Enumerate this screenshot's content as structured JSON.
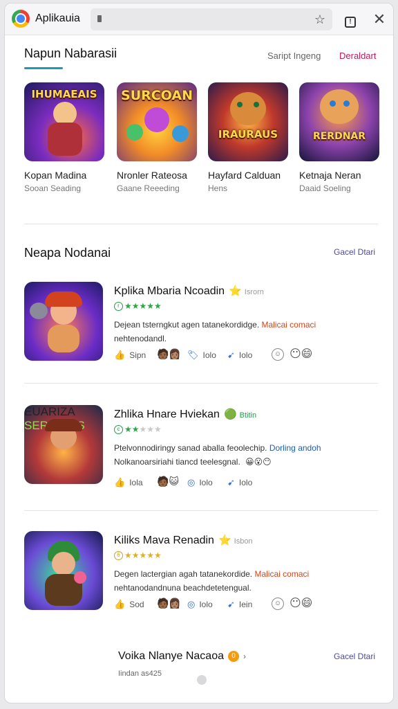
{
  "browser": {
    "title": "Aplikauia",
    "icons": [
      "chrome-logo-icon",
      "lock-icon",
      "star-icon",
      "tab-icon",
      "close-icon"
    ]
  },
  "section1": {
    "title": "Napun Nabarasii",
    "link1": "Saript Ingeng",
    "link2": "Deraldart",
    "cards": [
      {
        "art_text": "IHUMAEAIS",
        "title": "Kopan Madina",
        "subtitle": "Sooan Seading"
      },
      {
        "art_text": "SURCOAN",
        "title": "Nronler Rateosa",
        "subtitle": "Gaane Reeeding"
      },
      {
        "art_text": "IRAURAUS",
        "title": "Hayfard Calduan",
        "subtitle": "Hens"
      },
      {
        "art_text": "RERDNAR",
        "title": "Ketnaja Neran",
        "subtitle": "Daaid Soeling"
      }
    ]
  },
  "section2": {
    "title": "Neapa Nodanai",
    "link": "Gacel Dtari",
    "rows": [
      {
        "title": "Kplika Mbaria Ncoadin",
        "badge": "⭐",
        "badge_text": "Isrorn",
        "rating_filled": "★★★★★",
        "rating_empty": "",
        "desc_main": "Dejean tsterngkut agen tatanekordidge.",
        "desc_highlight": "Malicai comaci",
        "desc_line2": "nehtenodandl.",
        "act1": "Sipn",
        "act2": "Iolo",
        "act3": "Iolo"
      },
      {
        "title": "Zhlika Hnare Hviekan",
        "badge": "🟢",
        "badge_text": "Btitin",
        "rating_filled": "★★",
        "rating_empty": "★★★",
        "desc_main": "Ptelvonnodiringy sanad aballa feoolechip.",
        "desc_highlight": "Dorling andoh",
        "desc_line2": "Nolkanoarsiriahi tiancd teelesgnal.",
        "act1": "Iola",
        "act2": "Iolo",
        "act3": "Iolo"
      },
      {
        "title": "Kiliks Mava Renadin",
        "badge": "⭐",
        "badge_text": "Isbon",
        "rating_filled": "★★★★★",
        "rating_empty": "",
        "desc_main": "Degen lactergian agah tatanekordide.",
        "desc_highlight": "Malicai comaci",
        "desc_line2": "nehtanodandnuna beachdetetengual.",
        "act1": "Sod",
        "act2": "Iolo",
        "act3": "Iein"
      }
    ]
  },
  "footer": {
    "title": "Voika Nlanye Nacaoa",
    "subtitle": "Iindan as425",
    "link": "Gacel Dtari"
  }
}
